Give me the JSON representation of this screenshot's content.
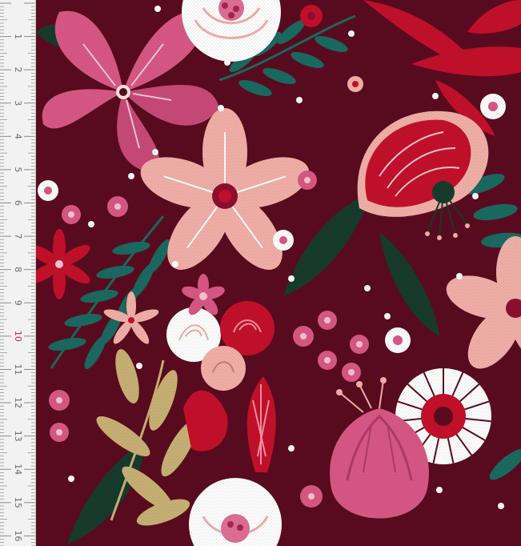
{
  "colors": {
    "background": "#5b0b1f",
    "deep_red": "#c4102b",
    "pink": "#d95885",
    "light_pink": "#f2b0a8",
    "white": "#ffffff",
    "teal": "#1b6a61",
    "dark_green": "#173b2d",
    "gold": "#c8b174",
    "ruler_bg": "#f2f2f2",
    "ruler_text": "#6b6b6b",
    "ruler_highlight": "#d32020"
  },
  "ruler": {
    "unit": "cm",
    "labels": [
      "1",
      "2",
      "3",
      "4",
      "5",
      "6",
      "7",
      "8",
      "9",
      "10",
      "11",
      "12",
      "13",
      "14",
      "15",
      "16"
    ],
    "highlight_label": "10"
  },
  "pattern": {
    "motif_icons": [
      "large-pink-flower-icon",
      "pale-pink-daisy-icon",
      "red-poppy-icon",
      "white-peony-icon",
      "red-tulip-bud-icon",
      "white-spiky-aster-icon",
      "pink-tulip-icon",
      "fern-leaf-icon",
      "gold-leaf-sprig-icon",
      "small-white-blossom-icon",
      "rosebud-cluster-icon"
    ]
  }
}
